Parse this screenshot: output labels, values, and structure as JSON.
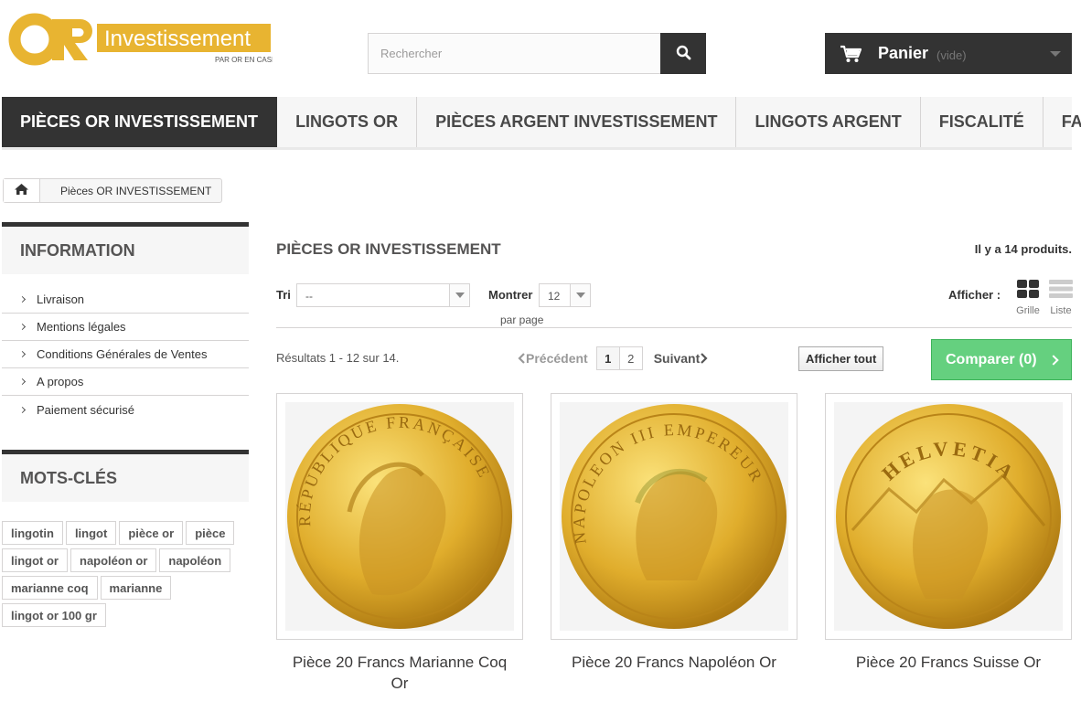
{
  "header": {
    "logo_text_main": "OR",
    "logo_text_brand": "Investissement",
    "logo_tagline": "PAR OR EN CASH",
    "search_placeholder": "Rechercher",
    "cart_label": "Panier",
    "cart_status": "(vide)",
    "icons": {
      "search": "search-icon",
      "cart": "cart-icon",
      "cart_caret": "caret-down-icon"
    }
  },
  "nav": {
    "items": [
      {
        "label": "PIÈCES OR INVESTISSEMENT",
        "active": true
      },
      {
        "label": "LINGOTS OR",
        "active": false
      },
      {
        "label": "PIÈCES ARGENT INVESTISSEMENT",
        "active": false
      },
      {
        "label": "LINGOTS ARGENT",
        "active": false
      },
      {
        "label": "FISCALITÉ",
        "active": false
      },
      {
        "label": "FAQ",
        "active": false
      }
    ]
  },
  "breadcrumb": {
    "home_icon": "home-icon",
    "current": "Pièces OR INVESTISSEMENT"
  },
  "sidebar": {
    "information": {
      "title": "INFORMATION",
      "items": [
        "Livraison",
        "Mentions légales",
        "Conditions Générales de Ventes",
        "A propos",
        "Paiement sécurisé"
      ]
    },
    "keywords": {
      "title": "MOTS-CLÉS",
      "tags": [
        "lingotin",
        "lingot",
        "pièce or",
        "pièce",
        "lingot or",
        "napoléon or",
        "napoléon",
        "marianne coq",
        "marianne",
        "lingot or 100 gr"
      ]
    }
  },
  "content": {
    "category_title": "PIÈCES OR INVESTISSEMENT",
    "product_count": "Il y a 14 produits.",
    "sort_label": "Tri",
    "sort_value": "--",
    "show_label": "Montrer",
    "show_value": "12",
    "per_page": "par page",
    "view_label": "Afficher :",
    "view_grid": "Grille",
    "view_list": "Liste",
    "results": "Résultats 1 - 12 sur 14.",
    "pagination": {
      "prev": "Précédent",
      "pages": [
        "1",
        "2"
      ],
      "current_page": "1",
      "next": "Suivant"
    },
    "show_all": "Afficher tout",
    "compare": "Comparer (0)"
  },
  "products": [
    {
      "name": "Pièce 20 Francs Marianne Coq Or",
      "coin_legend": "RÉPUBLIQUE FRANÇAISE",
      "image_icon": "gold-coin-marianne-image"
    },
    {
      "name": "Pièce 20 Francs Napoléon Or",
      "coin_legend": "NAPOLEON III EMPEREUR",
      "image_icon": "gold-coin-napoleon-image"
    },
    {
      "name": "Pièce 20 Francs Suisse Or",
      "coin_legend": "HELVETIA",
      "image_icon": "gold-coin-helvetia-image"
    }
  ],
  "colors": {
    "brand_gold": "#e8b431",
    "dark": "#333333",
    "compare_green": "#65d07f"
  }
}
